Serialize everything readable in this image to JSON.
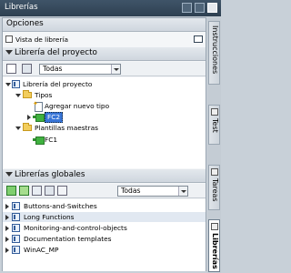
{
  "title": "Librerías",
  "options": {
    "header": "Opciones",
    "library_view": "Vista de librería"
  },
  "project_library": {
    "header": "Librería del proyecto",
    "filter": "Todas",
    "tree": {
      "root": "Librería del proyecto",
      "types_folder": "Tipos",
      "add_new_type": "Agregar nuevo tipo",
      "fc2": "FC2",
      "templates_folder": "Plantillas maestras",
      "fc1": "FC1"
    }
  },
  "global_libraries": {
    "header": "Librerías globales",
    "filter": "Todas",
    "items": [
      "Buttons-and-Switches",
      "Long Functions",
      "Monitoring-and-control-objects",
      "Documentation templates",
      "WinAC_MP"
    ]
  },
  "side_tabs": [
    "Instrucciones",
    "Test",
    "Tareas",
    "Librerías"
  ],
  "colors": {
    "accent": "#3875d7",
    "titlebar": "#2e4051",
    "block_green": "#3fb13f"
  }
}
